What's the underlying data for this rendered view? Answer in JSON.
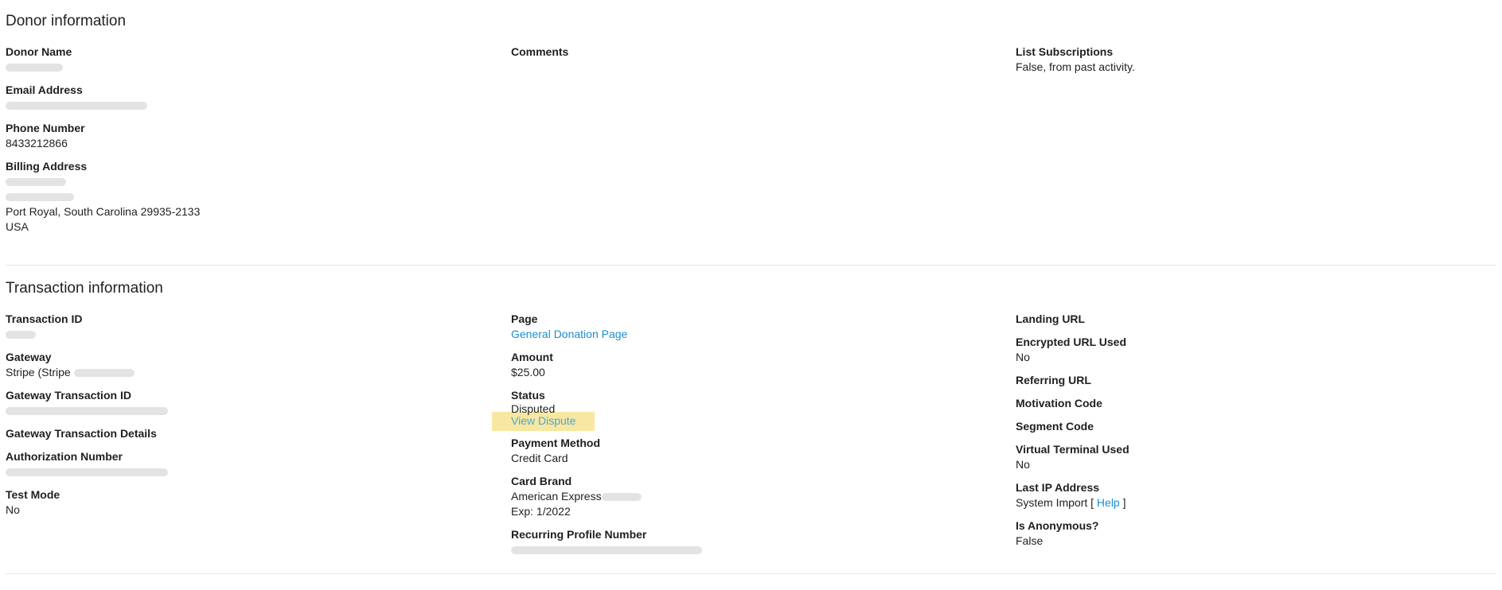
{
  "donor": {
    "title": "Donor information",
    "donor_name": {
      "label": "Donor Name"
    },
    "email": {
      "label": "Email Address"
    },
    "phone": {
      "label": "Phone Number",
      "value": "8433212866"
    },
    "billing": {
      "label": "Billing Address",
      "city_line": "Port Royal, South Carolina 29935-2133",
      "country": "USA"
    },
    "comments": {
      "label": "Comments"
    },
    "list_subscriptions": {
      "label": "List Subscriptions",
      "value": "False, from past activity."
    }
  },
  "transaction": {
    "title": "Transaction information",
    "transaction_id": {
      "label": "Transaction ID"
    },
    "gateway": {
      "label": "Gateway",
      "value": "Stripe (Stripe"
    },
    "gateway_transaction_id": {
      "label": "Gateway Transaction ID"
    },
    "gateway_transaction_details": {
      "label": "Gateway Transaction Details"
    },
    "authorization_number": {
      "label": "Authorization Number"
    },
    "test_mode": {
      "label": "Test Mode",
      "value": "No"
    },
    "page": {
      "label": "Page",
      "value": "General Donation Page"
    },
    "amount": {
      "label": "Amount",
      "value": "$25.00"
    },
    "status": {
      "label": "Status",
      "value": "Disputed",
      "link": "View Dispute"
    },
    "payment_method": {
      "label": "Payment Method",
      "value": "Credit Card"
    },
    "card_brand": {
      "label": "Card Brand",
      "value": "American Express",
      "exp": "Exp: 1/2022"
    },
    "recurring_profile": {
      "label": "Recurring Profile Number"
    },
    "landing_url": {
      "label": "Landing URL"
    },
    "encrypted_url": {
      "label": "Encrypted URL Used",
      "value": "No"
    },
    "referring_url": {
      "label": "Referring URL"
    },
    "motivation_code": {
      "label": "Motivation Code"
    },
    "segment_code": {
      "label": "Segment Code"
    },
    "virtual_terminal": {
      "label": "Virtual Terminal Used",
      "value": "No"
    },
    "last_ip": {
      "label": "Last IP Address",
      "value": "System Import",
      "bracket_open": "[",
      "help": "Help",
      "bracket_close": "]"
    },
    "anonymous": {
      "label": "Is Anonymous?",
      "value": "False"
    }
  },
  "colors": {
    "link": "#1a8fd0",
    "highlight": "#f7e7a1",
    "divider": "#e6e6e6",
    "redaction": "#e3e3e3"
  }
}
